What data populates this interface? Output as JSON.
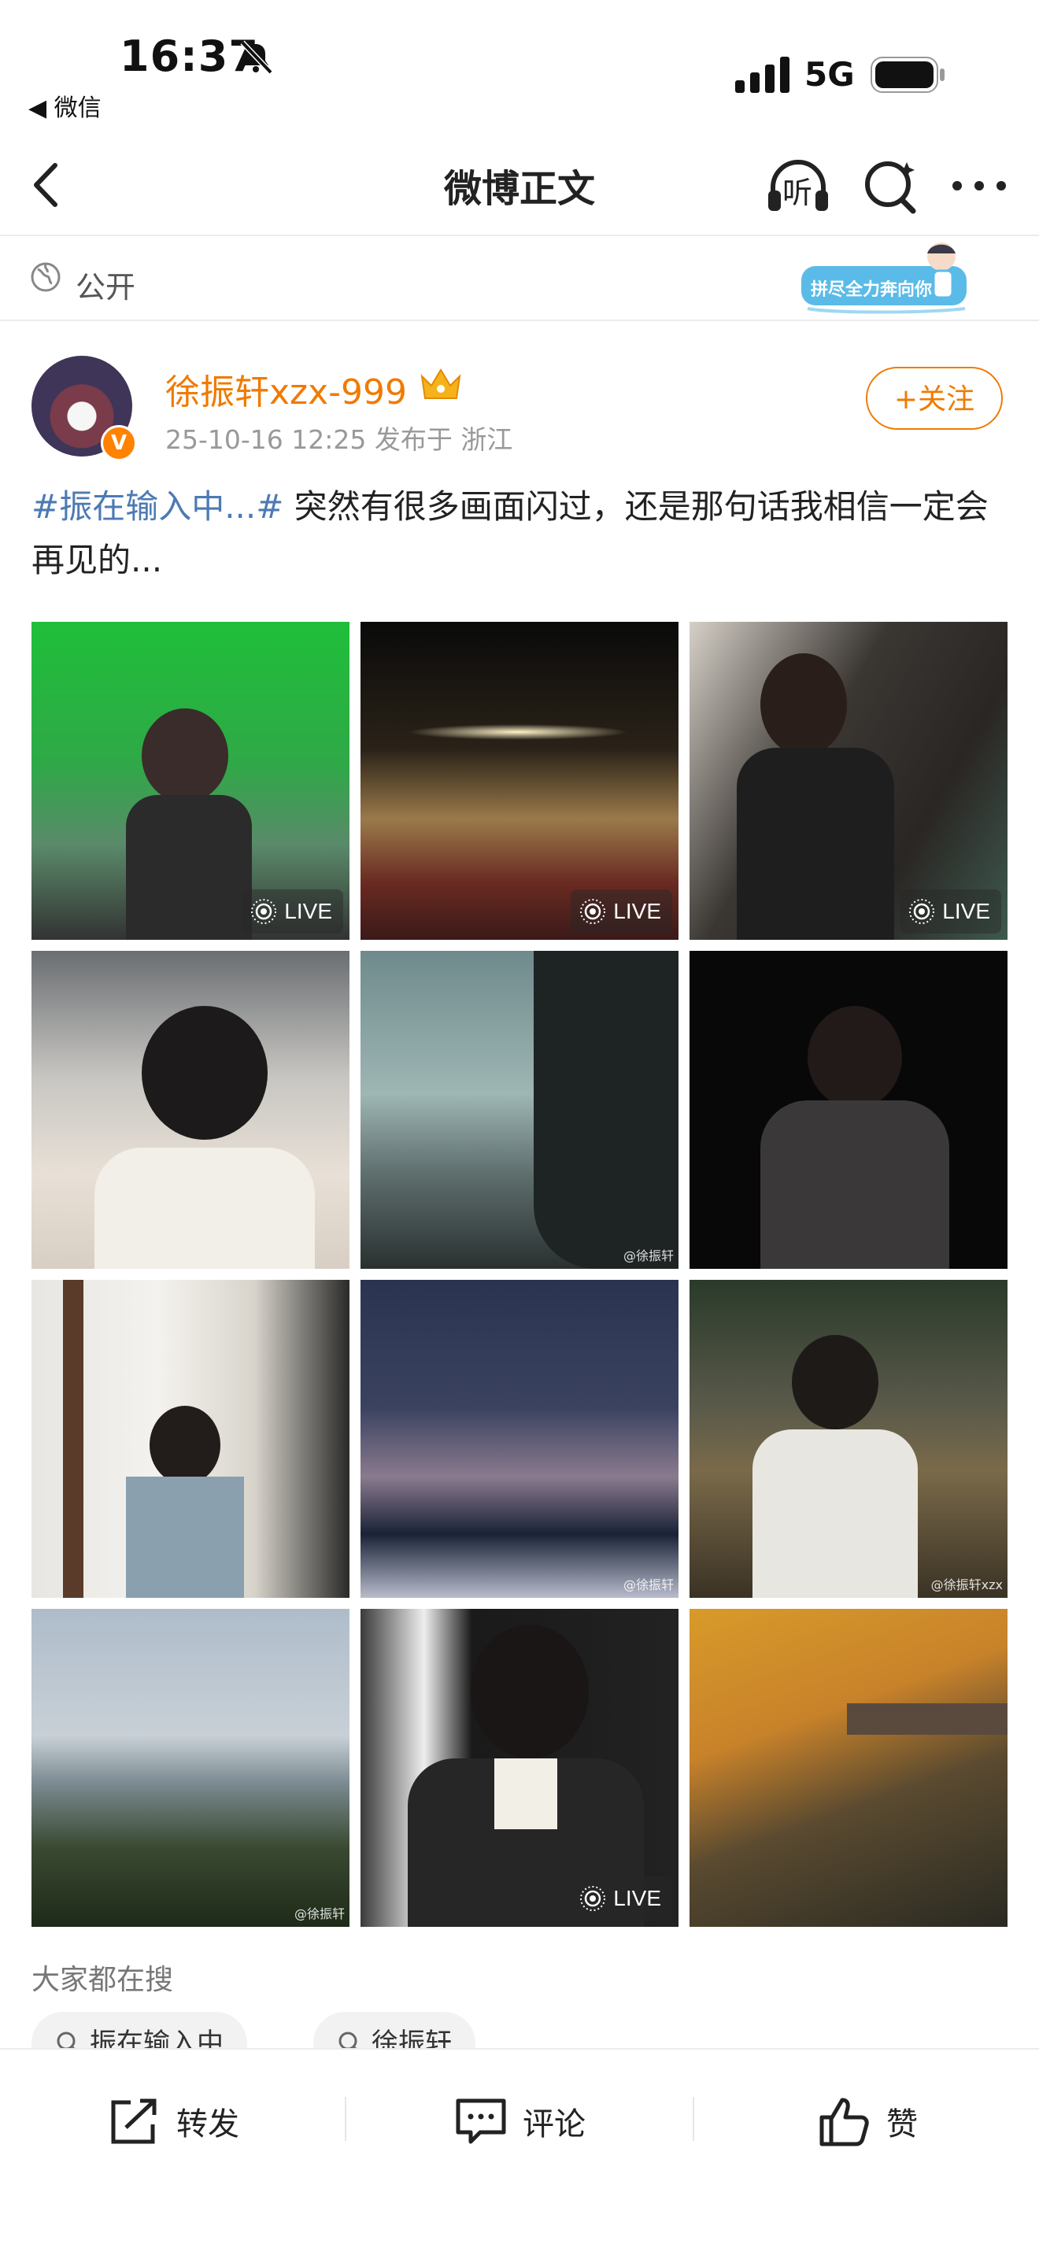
{
  "status_bar": {
    "time": "16:37",
    "back_app": "◀ 微信",
    "carrier": "5G"
  },
  "nav": {
    "title": "微博正文",
    "listen_label": "听"
  },
  "visibility": {
    "label": "公开",
    "sticker_text": "拼尽全力奔向你"
  },
  "author": {
    "name": "徐振轩xzx-999",
    "verified_mark": "V",
    "meta": "25-10-16 12:25  发布于 浙江",
    "follow_label": "+关注"
  },
  "post": {
    "topic": "#振在输入中...#",
    "text": " 突然有很多画面闪过，还是那句话我相信一定会再见的..."
  },
  "images": [
    {
      "live": true,
      "live_label": "LIVE",
      "watermark": ""
    },
    {
      "live": true,
      "live_label": "LIVE",
      "watermark": ""
    },
    {
      "live": true,
      "live_label": "LIVE",
      "watermark": ""
    },
    {
      "live": false,
      "live_label": "",
      "watermark": ""
    },
    {
      "live": false,
      "live_label": "",
      "watermark": "@徐振轩"
    },
    {
      "live": false,
      "live_label": "",
      "watermark": ""
    },
    {
      "live": false,
      "live_label": "",
      "watermark": ""
    },
    {
      "live": false,
      "live_label": "",
      "watermark": "@徐振轩"
    },
    {
      "live": false,
      "live_label": "",
      "watermark": "@徐振轩xzx"
    },
    {
      "live": false,
      "live_label": "",
      "watermark": "@徐振轩"
    },
    {
      "live": true,
      "live_label": "LIVE",
      "watermark": ""
    },
    {
      "live": false,
      "live_label": "",
      "watermark": ""
    }
  ],
  "hot_search": {
    "title": "大家都在搜",
    "chips": [
      "振在输入中",
      "徐振轩"
    ]
  },
  "actions": {
    "repost": "转发",
    "comment": "评论",
    "like": "赞"
  },
  "colors": {
    "accent_orange": "#f07a00",
    "topic_blue": "#4d7ab3"
  }
}
